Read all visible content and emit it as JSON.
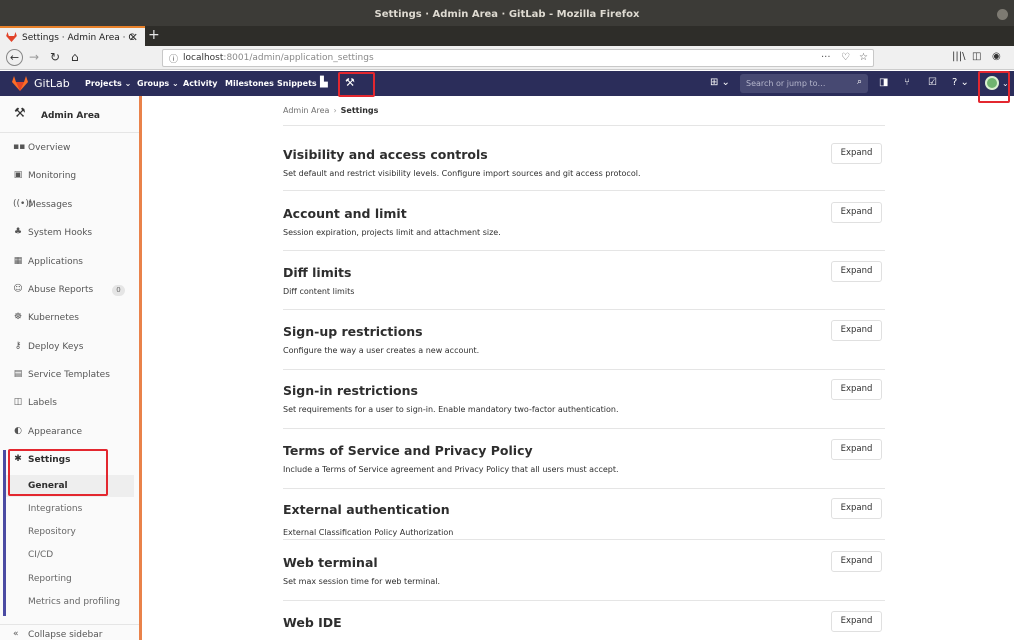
{
  "os": {
    "window_title": "Settings · Admin Area · GitLab - Mozilla Firefox"
  },
  "browser": {
    "tab_title": "Settings · Admin Area · C",
    "tab_close": "✕",
    "new_tab": "+",
    "url_host": "localhost",
    "url_rest": ":8001/admin/application_settings",
    "icons": [
      "back-icon",
      "forward-icon",
      "reload-icon",
      "home-icon",
      "page-actions-icon",
      "pocket-icon",
      "bookmark-star-icon",
      "library-icon",
      "sidebar-icon",
      "account-icon"
    ]
  },
  "gitlab": {
    "brand": "GitLab",
    "menu": {
      "projects": "Projects ⌄",
      "groups": "Groups ⌄",
      "activity": "Activity",
      "milestones": "Milestones",
      "snippets": "Snippets"
    },
    "search_placeholder": "Search or jump to…",
    "colors": {
      "header": "#2b2d5a",
      "accent": "#e9824a",
      "highlight_box": "#e3272f"
    }
  },
  "sidebar": {
    "title": "Admin Area",
    "items": [
      {
        "label": "Overview",
        "icon": "overview-icon"
      },
      {
        "label": "Monitoring",
        "icon": "monitoring-icon"
      },
      {
        "label": "Messages",
        "icon": "messages-icon"
      },
      {
        "label": "System Hooks",
        "icon": "hooks-icon"
      },
      {
        "label": "Applications",
        "icon": "applications-icon"
      },
      {
        "label": "Abuse Reports",
        "icon": "abuse-icon",
        "badge": "0"
      },
      {
        "label": "Kubernetes",
        "icon": "kubernetes-icon"
      },
      {
        "label": "Deploy Keys",
        "icon": "key-icon"
      },
      {
        "label": "Service Templates",
        "icon": "template-icon"
      },
      {
        "label": "Labels",
        "icon": "labels-icon"
      },
      {
        "label": "Appearance",
        "icon": "appearance-icon"
      }
    ],
    "settings": {
      "label": "Settings",
      "icon": "gear-icon"
    },
    "settings_sub": [
      "General",
      "Integrations",
      "Repository",
      "CI/CD",
      "Reporting",
      "Metrics and profiling"
    ],
    "collapse_label": "Collapse sidebar"
  },
  "main": {
    "breadcrumb": {
      "parent": "Admin Area",
      "sep": "›",
      "current": "Settings"
    },
    "expand_label": "Expand",
    "sections": [
      {
        "title": "Visibility and access controls",
        "desc": "Set default and restrict visibility levels. Configure import sources and git access protocol."
      },
      {
        "title": "Account and limit",
        "desc": "Session expiration, projects limit and attachment size."
      },
      {
        "title": "Diff limits",
        "desc": "Diff content limits"
      },
      {
        "title": "Sign-up restrictions",
        "desc": "Configure the way a user creates a new account."
      },
      {
        "title": "Sign-in restrictions",
        "desc": "Set requirements for a user to sign-in. Enable mandatory two-factor authentication."
      },
      {
        "title": "Terms of Service and Privacy Policy",
        "desc": "Include a Terms of Service agreement and Privacy Policy that all users must accept."
      },
      {
        "title": "External authentication",
        "desc": "External Classification Policy Authorization"
      },
      {
        "title": "Web terminal",
        "desc": "Set max session time for web terminal."
      },
      {
        "title": "Web IDE",
        "desc": ""
      }
    ]
  }
}
